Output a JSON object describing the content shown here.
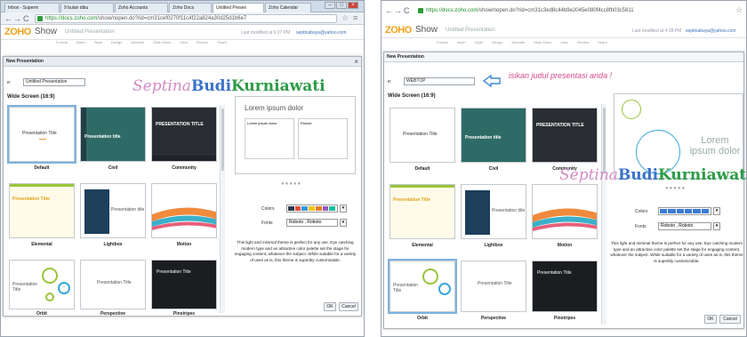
{
  "left": {
    "browser_tabs": [
      "Inbox - Superm",
      "9 bulan dibu",
      "Zoho Accounts",
      "Zoho Docs",
      "Untitled Presen",
      "Zoho Calendar"
    ],
    "url_host": "https://docs.zoho.com",
    "url_rest": "/show/nopen.do?rid=cm31cef0270f11c4f22a824a30d25d1b6e7",
    "app_logo": "ZOHO",
    "app_name": "Show",
    "presentation_name": "Untitled Presentation",
    "last_modified": "Last modified at 6:27 PM",
    "user": "septinabuya@yahoo.com",
    "menu": [
      "Format",
      "Insert",
      "Style",
      "Design",
      "Animate",
      "Slide Show",
      "View",
      "Review",
      "Share"
    ],
    "dialog_title": "New Presentation",
    "title_label": "e:",
    "title_value": "Untitled Presentation",
    "section": "Wide Screen (16:9)",
    "themes": [
      {
        "name": "Default",
        "title": "Presentation Title"
      },
      {
        "name": "Civil",
        "title": "Presentation title"
      },
      {
        "name": "Community",
        "title": "PRESENTATION TITLE"
      },
      {
        "name": "Elemental",
        "title": "Presentation Title"
      },
      {
        "name": "Lightbox",
        "title": "Presentation title"
      },
      {
        "name": "Motion",
        "title": ""
      },
      {
        "name": "Orbit",
        "title": "Presentation Title"
      },
      {
        "name": "Perspective",
        "title": "Presentation Title"
      },
      {
        "name": "Pinstripes",
        "title": "Presentation Title"
      }
    ],
    "preview_heading": "Lorem ipsum dolor",
    "preview_col1": "Lorem ipsum dolor",
    "preview_col2": "Picture",
    "colors_label": "Colors",
    "fonts_label": "Fonts",
    "font_value": "Roboto , Roboto",
    "description": "This light and minimal theme is perfect for any use. Eye catching modern type and an attractive color palette set the stage for engaging content, whatever the subject. While suitable for a variety of uses as is, this theme is superbly customizable.",
    "ok": "OK",
    "cancel": "Cancel"
  },
  "right": {
    "url_host": "https://docs.zoho.com",
    "url_rest": "/show/nopen.do?rid=cm31c3ed8c44b9e2045e080f4cc8fb03c5811",
    "app_logo": "ZOHO",
    "app_name": "Show",
    "presentation_name": "Untitled Presentation",
    "last_modified": "Last modified at 4:38 PM",
    "user": "septinabuya@yahoo.com",
    "menu": [
      "Format",
      "Insert",
      "Style",
      "Design",
      "Animate",
      "Slide Show",
      "View",
      "Review",
      "Share"
    ],
    "dialog_title": "New Presentation",
    "title_label": "e:",
    "title_value": "WEBTOP",
    "annotation": "isikan judul presentasi anda !",
    "section": "Wide Screen (16:9)",
    "themes": [
      {
        "name": "Default",
        "title": "Presentation Title"
      },
      {
        "name": "Civil",
        "title": "Presentation title"
      },
      {
        "name": "Community",
        "title": "PRESENTATION TITLE"
      },
      {
        "name": "Elemental",
        "title": "Presentation Title"
      },
      {
        "name": "Lightbox",
        "title": "Presentation title"
      },
      {
        "name": "Motion",
        "title": ""
      },
      {
        "name": "Orbit",
        "title": "Presentation Title"
      },
      {
        "name": "Perspective",
        "title": "Presentation Title"
      },
      {
        "name": "Pinstripes",
        "title": "Presentation Title"
      }
    ],
    "preview_heading": "Lorem ipsum dolor",
    "colors_label": "Colors",
    "fonts_label": "Fonts",
    "font_value": "Roboto , Roboto",
    "description": "This light and minimal theme is perfect for any use. Eye catching modern type and an attractive color palette set the stage for engaging content, whatever the subject. While suitable for a variety of uses as is, this theme is superbly customizable.",
    "ok": "OK",
    "cancel": "Cancel"
  },
  "watermark": {
    "part1": "Septina",
    "part2": "Budi",
    "part3": "Kurniawati"
  },
  "colors": {
    "swatches": [
      "#2c3e50",
      "#e74c3c",
      "#3498db",
      "#f1c40f",
      "#e67e22",
      "#9b59b6",
      "#1abc9c"
    ],
    "swatches_right": [
      "#3a7bd5",
      "#3a7bd5",
      "#3a7bd5",
      "#3a7bd5",
      "#3a7bd5",
      "#3a7bd5"
    ],
    "accent": "#3da7e0"
  }
}
